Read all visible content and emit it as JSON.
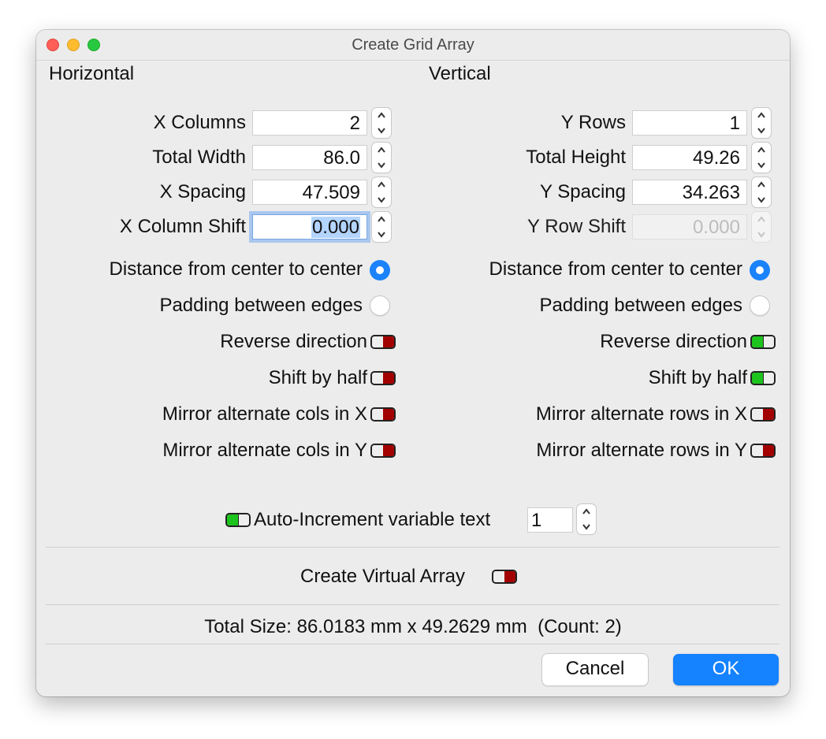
{
  "window": {
    "title": "Create Grid Array"
  },
  "horizontal": {
    "heading": "Horizontal",
    "x_columns_label": "X Columns",
    "x_columns_value": "2",
    "total_width_label": "Total Width",
    "total_width_value": "86.0",
    "x_spacing_label": "X Spacing",
    "x_spacing_value": "47.509",
    "x_column_shift_label": "X Column Shift",
    "x_column_shift_value": "0.000",
    "center_label": "Distance from center to center",
    "center_selected": true,
    "padding_label": "Padding between edges",
    "padding_selected": false,
    "reverse_label": "Reverse direction",
    "reverse_on": false,
    "shift_half_label": "Shift by half",
    "shift_half_on": false,
    "mirror_x_label": "Mirror alternate cols in X",
    "mirror_x_on": false,
    "mirror_y_label": "Mirror alternate cols in Y",
    "mirror_y_on": false
  },
  "vertical": {
    "heading": "Vertical",
    "y_rows_label": "Y Rows",
    "y_rows_value": "1",
    "total_height_label": "Total Height",
    "total_height_value": "49.26",
    "y_spacing_label": "Y Spacing",
    "y_spacing_value": "34.263",
    "y_row_shift_label": "Y Row Shift",
    "y_row_shift_value": "0.000",
    "center_label": "Distance from center to center",
    "center_selected": true,
    "padding_label": "Padding between edges",
    "padding_selected": false,
    "reverse_label": "Reverse direction",
    "reverse_on": true,
    "shift_half_label": "Shift by half",
    "shift_half_on": true,
    "mirror_x_label": "Mirror alternate rows in X",
    "mirror_x_on": false,
    "mirror_y_label": "Mirror alternate rows in Y",
    "mirror_y_on": false
  },
  "auto_increment": {
    "label": "Auto-Increment variable text",
    "on": true,
    "value": "1"
  },
  "virtual_array": {
    "label": "Create Virtual Array",
    "on": false
  },
  "summary": {
    "text": "Total Size: 86.0183 mm x 49.2629 mm  (Count: 2)"
  },
  "buttons": {
    "cancel": "Cancel",
    "ok": "OK"
  },
  "colors": {
    "accent": "#1582ff",
    "radio_on": "#1a82fb",
    "toggle_on": "#1ec41e",
    "toggle_off": "#a30000",
    "focus_ring": "#a9c7ef",
    "window_bg": "#ececec"
  }
}
